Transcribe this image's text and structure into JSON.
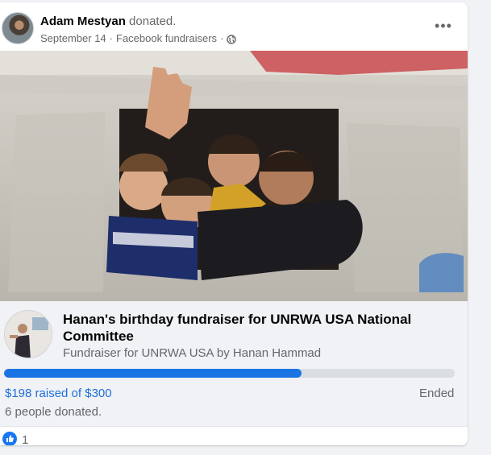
{
  "post": {
    "author_name": "Adam Mestyan",
    "author_action": "donated.",
    "date": "September 14",
    "separator": "·",
    "source": "Facebook fundraisers",
    "separator2": "·",
    "privacy_icon": "globe-icon",
    "more_label": "•••"
  },
  "fundraiser": {
    "title": "Hanan's birthday fundraiser for UNRWA USA National Committee",
    "subtitle": "Fundraiser for UNRWA USA by Hanan Hammad",
    "progress_fraction": 0.66,
    "raised_text": "$198 raised of $300",
    "status": "Ended",
    "donors_text": "6 people donated."
  },
  "reactions": {
    "icon": "like-icon",
    "count": "1"
  },
  "colors": {
    "accent": "#1b74e4",
    "raised_text": "#216fdb",
    "secondary_text": "#65676b",
    "card_bg": "#f0f2f5"
  }
}
